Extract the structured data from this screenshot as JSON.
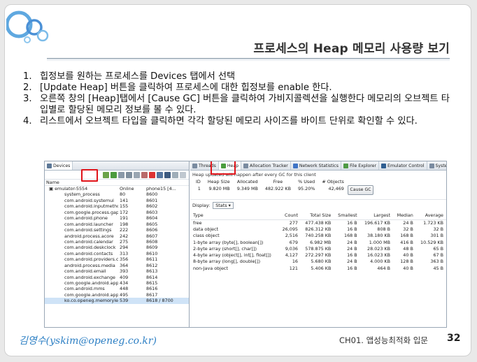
{
  "slide": {
    "title": "프로세스의 Heap 메모리 사용량 보기",
    "steps": [
      {
        "num": "1.",
        "text": "힙정보를 원하는 프로세스를 Devices 탭에서 선택"
      },
      {
        "num": "2.",
        "text": "[Update Heap] 버튼을 클릭하여 프로세스에 대한 힙정보를 enable 한다."
      },
      {
        "num": "3.",
        "text": "오른쪽 창의 [Heap]탭에서 [Cause GC] 버튼을 클릭하여 가비지콜렉션을 실행한다 메모리의 오브젝트 타입별로 할당된 메모리 정보를 볼 수 있다."
      },
      {
        "num": "4.",
        "text": "리스트에서 오브젝트 타입을 클릭하면 각각 할당된 메모리 사이즈를 바이트 단위로 확인할 수 있다."
      }
    ],
    "author": "김영수(yskim@openeg.co.kr)",
    "chapter": "CH01. 앱성능최적화 입문",
    "page_number": "32"
  },
  "devices_panel": {
    "tab_label": "Devices",
    "header_name": "Name",
    "device": {
      "name": "emulator-5554",
      "status": "Online",
      "target": "phone15 [4..."
    },
    "processes": [
      {
        "name": "system_process",
        "pid": "80",
        "port": "8600"
      },
      {
        "name": "com.android.systemui",
        "pid": "141",
        "port": "8601"
      },
      {
        "name": "com.android.inputmethod.",
        "pid": "155",
        "port": "8602"
      },
      {
        "name": "com.google.process.gapps",
        "pid": "172",
        "port": "8603"
      },
      {
        "name": "com.android.phone",
        "pid": "191",
        "port": "8604"
      },
      {
        "name": "com.android.launcher",
        "pid": "198",
        "port": "8605"
      },
      {
        "name": "com.android.settings",
        "pid": "222",
        "port": "8606"
      },
      {
        "name": "android.process.acore",
        "pid": "242",
        "port": "8607"
      },
      {
        "name": "com.android.calendar",
        "pid": "275",
        "port": "8608"
      },
      {
        "name": "com.android.deskclock",
        "pid": "294",
        "port": "8609"
      },
      {
        "name": "com.android.contacts",
        "pid": "313",
        "port": "8610"
      },
      {
        "name": "com.android.providers.cale",
        "pid": "356",
        "port": "8611"
      },
      {
        "name": "android.process.media",
        "pid": "364",
        "port": "8612"
      },
      {
        "name": "com.android.email",
        "pid": "393",
        "port": "8613"
      },
      {
        "name": "com.android.exchange",
        "pid": "409",
        "port": "8614"
      },
      {
        "name": "com.google.android.apps.r",
        "pid": "434",
        "port": "8615"
      },
      {
        "name": "com.android.mms",
        "pid": "448",
        "port": "8616"
      },
      {
        "name": "com.google.android.apps.r",
        "pid": "495",
        "port": "8617"
      },
      {
        "name": "ko.co.openeg.memoryleak",
        "pid": "539",
        "port": "8618 / 8700"
      }
    ]
  },
  "right_tabs": [
    {
      "label": "Threads",
      "color": "#7a8ba0"
    },
    {
      "label": "Heap",
      "color": "#4a9d3e"
    },
    {
      "label": "Allocation Tracker",
      "color": "#7a8ba0"
    },
    {
      "label": "Network Statistics",
      "color": "#3f74c6"
    },
    {
      "label": "File Explorer",
      "color": "#4f9a45"
    },
    {
      "label": "Emulator Control",
      "color": "#2f5e91"
    },
    {
      "label": "System Infor",
      "color": "#7a8ba0"
    }
  ],
  "heap": {
    "info": "Heap updated will happen after every GC for this client",
    "summary_headers": [
      "ID",
      "Heap Size",
      "Allocated",
      "Free",
      "% Used",
      "# Objects"
    ],
    "summary_row": [
      "1",
      "9.820 MB",
      "9.349 MB",
      "482.922 KB",
      "95.20%",
      "42,469"
    ],
    "cause_gc_label": "Cause GC",
    "display_label": "Display:",
    "display_value": "Stats",
    "stats_headers": [
      "Type",
      "Count",
      "Total Size",
      "Smallest",
      "Largest",
      "Median",
      "Average"
    ],
    "stats_rows": [
      [
        "free",
        "277",
        "477.438 KB",
        "16 B",
        "196.617 KB",
        "24 B",
        "1.723 KB"
      ],
      [
        "data object",
        "26,095",
        "826.312 KB",
        "16 B",
        "808 B",
        "32 B",
        "32 B"
      ],
      [
        "class object",
        "2,516",
        "740.258 KB",
        "168 B",
        "38.180 KB",
        "168 B",
        "301 B"
      ],
      [
        "1-byte array (byte[], boolean[])",
        "679",
        "6.982 MB",
        "24 B",
        "1.000 MB",
        "416 B",
        "10.529 KB"
      ],
      [
        "2-byte array (short[], char[])",
        "9,036",
        "578.875 KB",
        "24 B",
        "28.023 KB",
        "48 B",
        "65 B"
      ],
      [
        "4-byte array (object[], int[], float[])",
        "4,127",
        "272.297 KB",
        "16 B",
        "16.023 KB",
        "40 B",
        "67 B"
      ],
      [
        "8-byte array (long[], double[])",
        "16",
        "5.680 KB",
        "24 B",
        "4.000 KB",
        "128 B",
        "363 B"
      ],
      [
        "non-Java object",
        "121",
        "5.406 KB",
        "16 B",
        "464 B",
        "40 B",
        "45 B"
      ]
    ]
  },
  "colors": {
    "highlight": "#e0141a",
    "author": "#2c7fc4",
    "selection": "#cfe3f7"
  }
}
